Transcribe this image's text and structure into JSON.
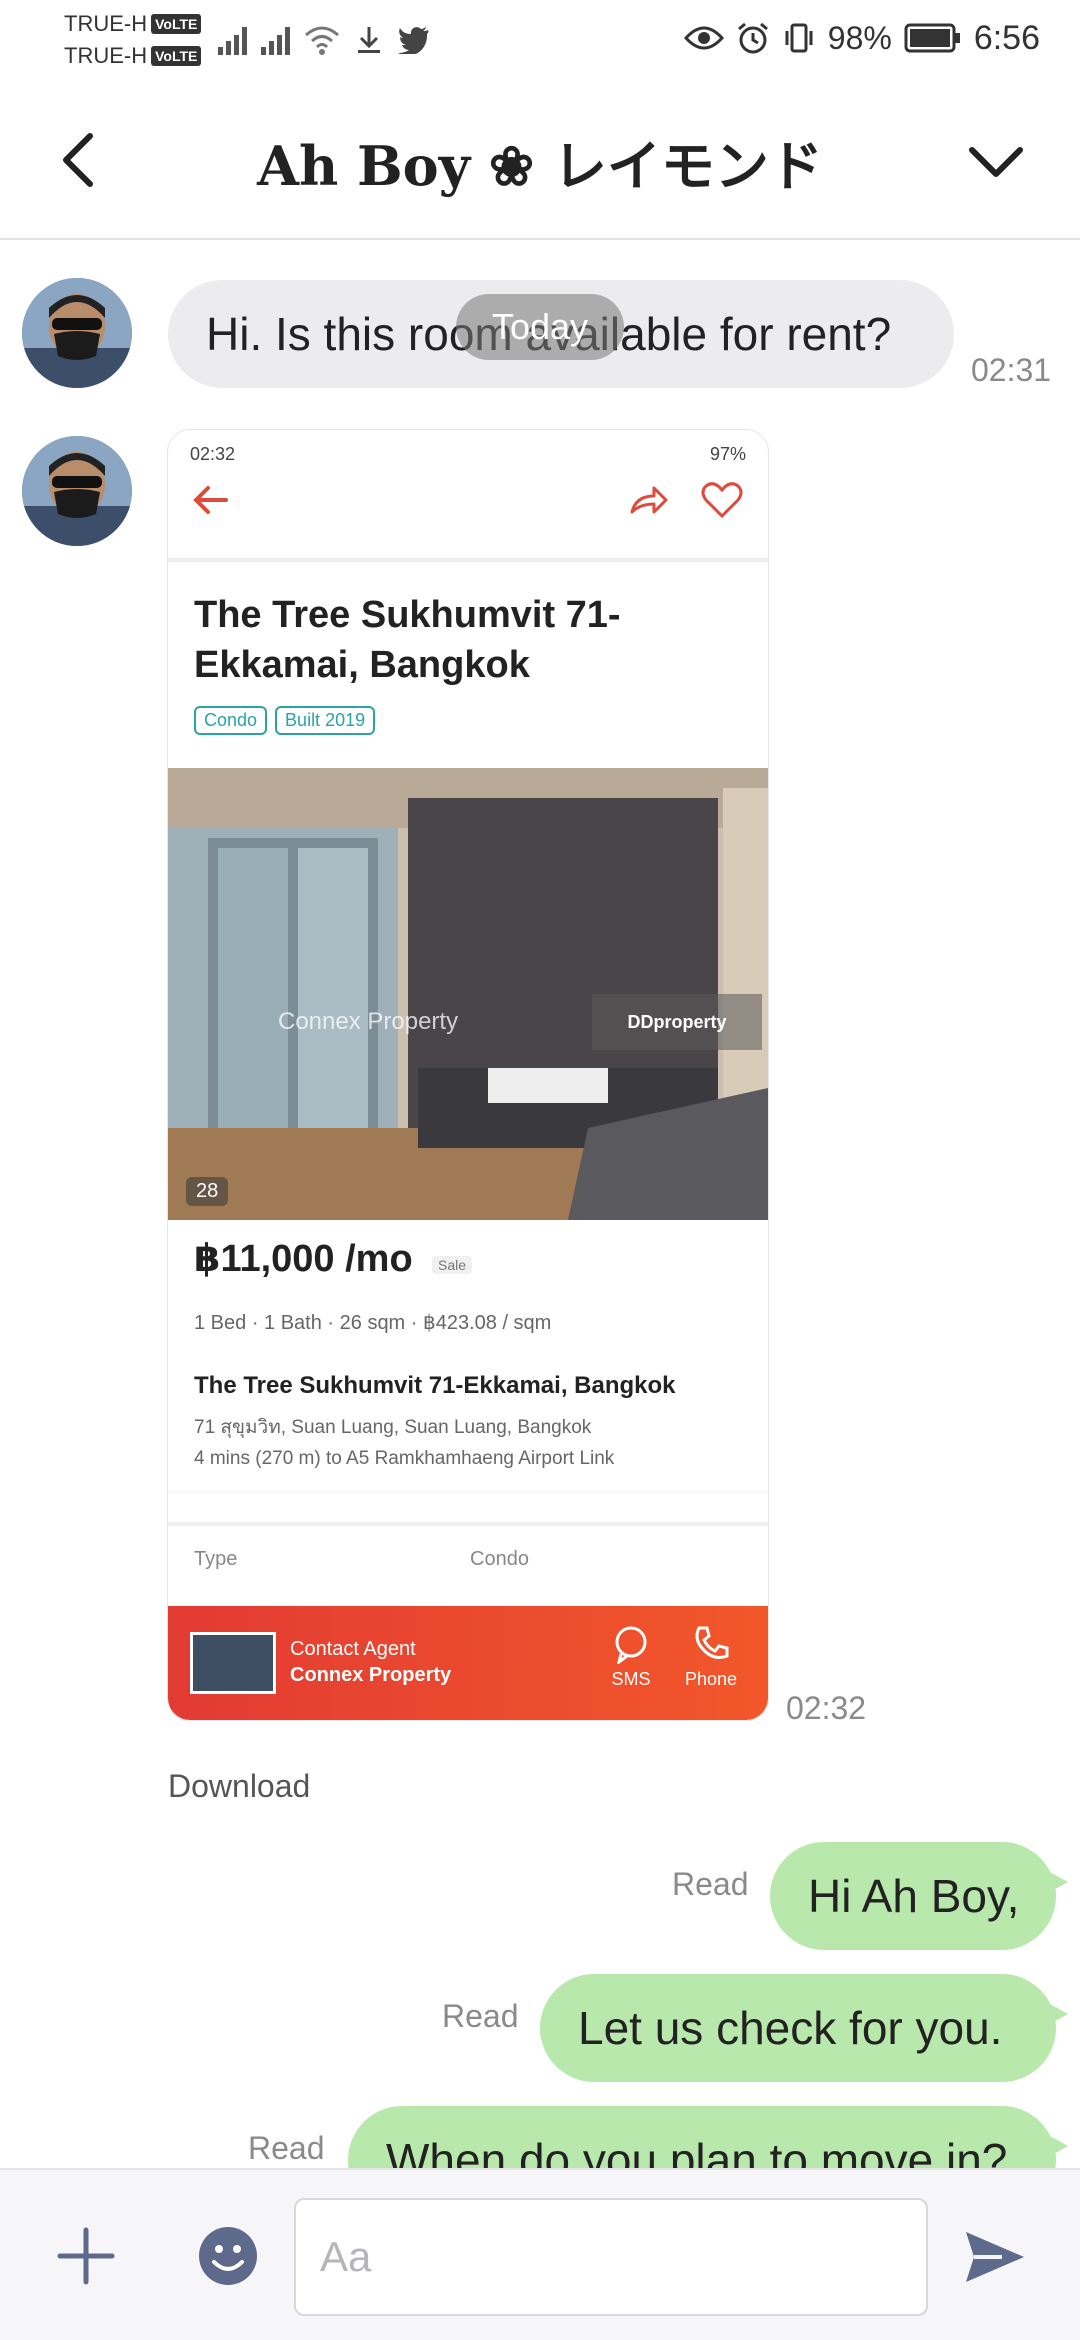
{
  "status_bar": {
    "carrier_1": "TRUE-H",
    "carrier_2": "TRUE-H",
    "volte": "VoLTE",
    "battery": "98%",
    "time": "6:56"
  },
  "header": {
    "title": "Ah Boy ❀ レイモンド"
  },
  "chat": {
    "date_separator": "Today",
    "incoming_1": {
      "text": "Hi. Is this room available for rent?",
      "time": "02:31"
    },
    "incoming_2": {
      "time": "02:32",
      "download_label": "Download",
      "listing": {
        "status_time": "02:32",
        "status_right": "97%",
        "title": "The Tree Sukhumvit 71-Ekkamai, Bangkok",
        "tags": [
          "Condo",
          "Built 2019"
        ],
        "photo_count": "28",
        "watermark_agent": "Connex Property",
        "watermark_brand": "DDproperty",
        "price": "฿11,000 /mo",
        "price_badge": "Sale",
        "specs": "1 Bed · 1 Bath · 26 sqm · ฿423.08 / sqm",
        "name": "The Tree Sukhumvit 71-Ekkamai, Bangkok",
        "address": "71 สุขุมวิท, Suan Luang, Suan Luang, Bangkok",
        "transit": "4 mins (270 m) to A5 Ramkhamhaeng Airport Link",
        "type_label": "Type",
        "type_value": "Condo",
        "contact_line_1": "Contact Agent",
        "contact_line_2": "Connex Property",
        "sms_label": "SMS",
        "phone_label": "Phone"
      }
    },
    "outgoing": [
      {
        "text": "Hi Ah Boy,",
        "status": "Read"
      },
      {
        "text": "Let us check for you.",
        "status": "Read"
      },
      {
        "text": "When do you plan to move in?",
        "status": "Read"
      }
    ]
  },
  "input": {
    "placeholder": "Aa"
  },
  "colors": {
    "outgoing_bubble": "#b9e8ad",
    "incoming_bubble": "#ececee",
    "icon_accent": "#5e6a8c"
  }
}
